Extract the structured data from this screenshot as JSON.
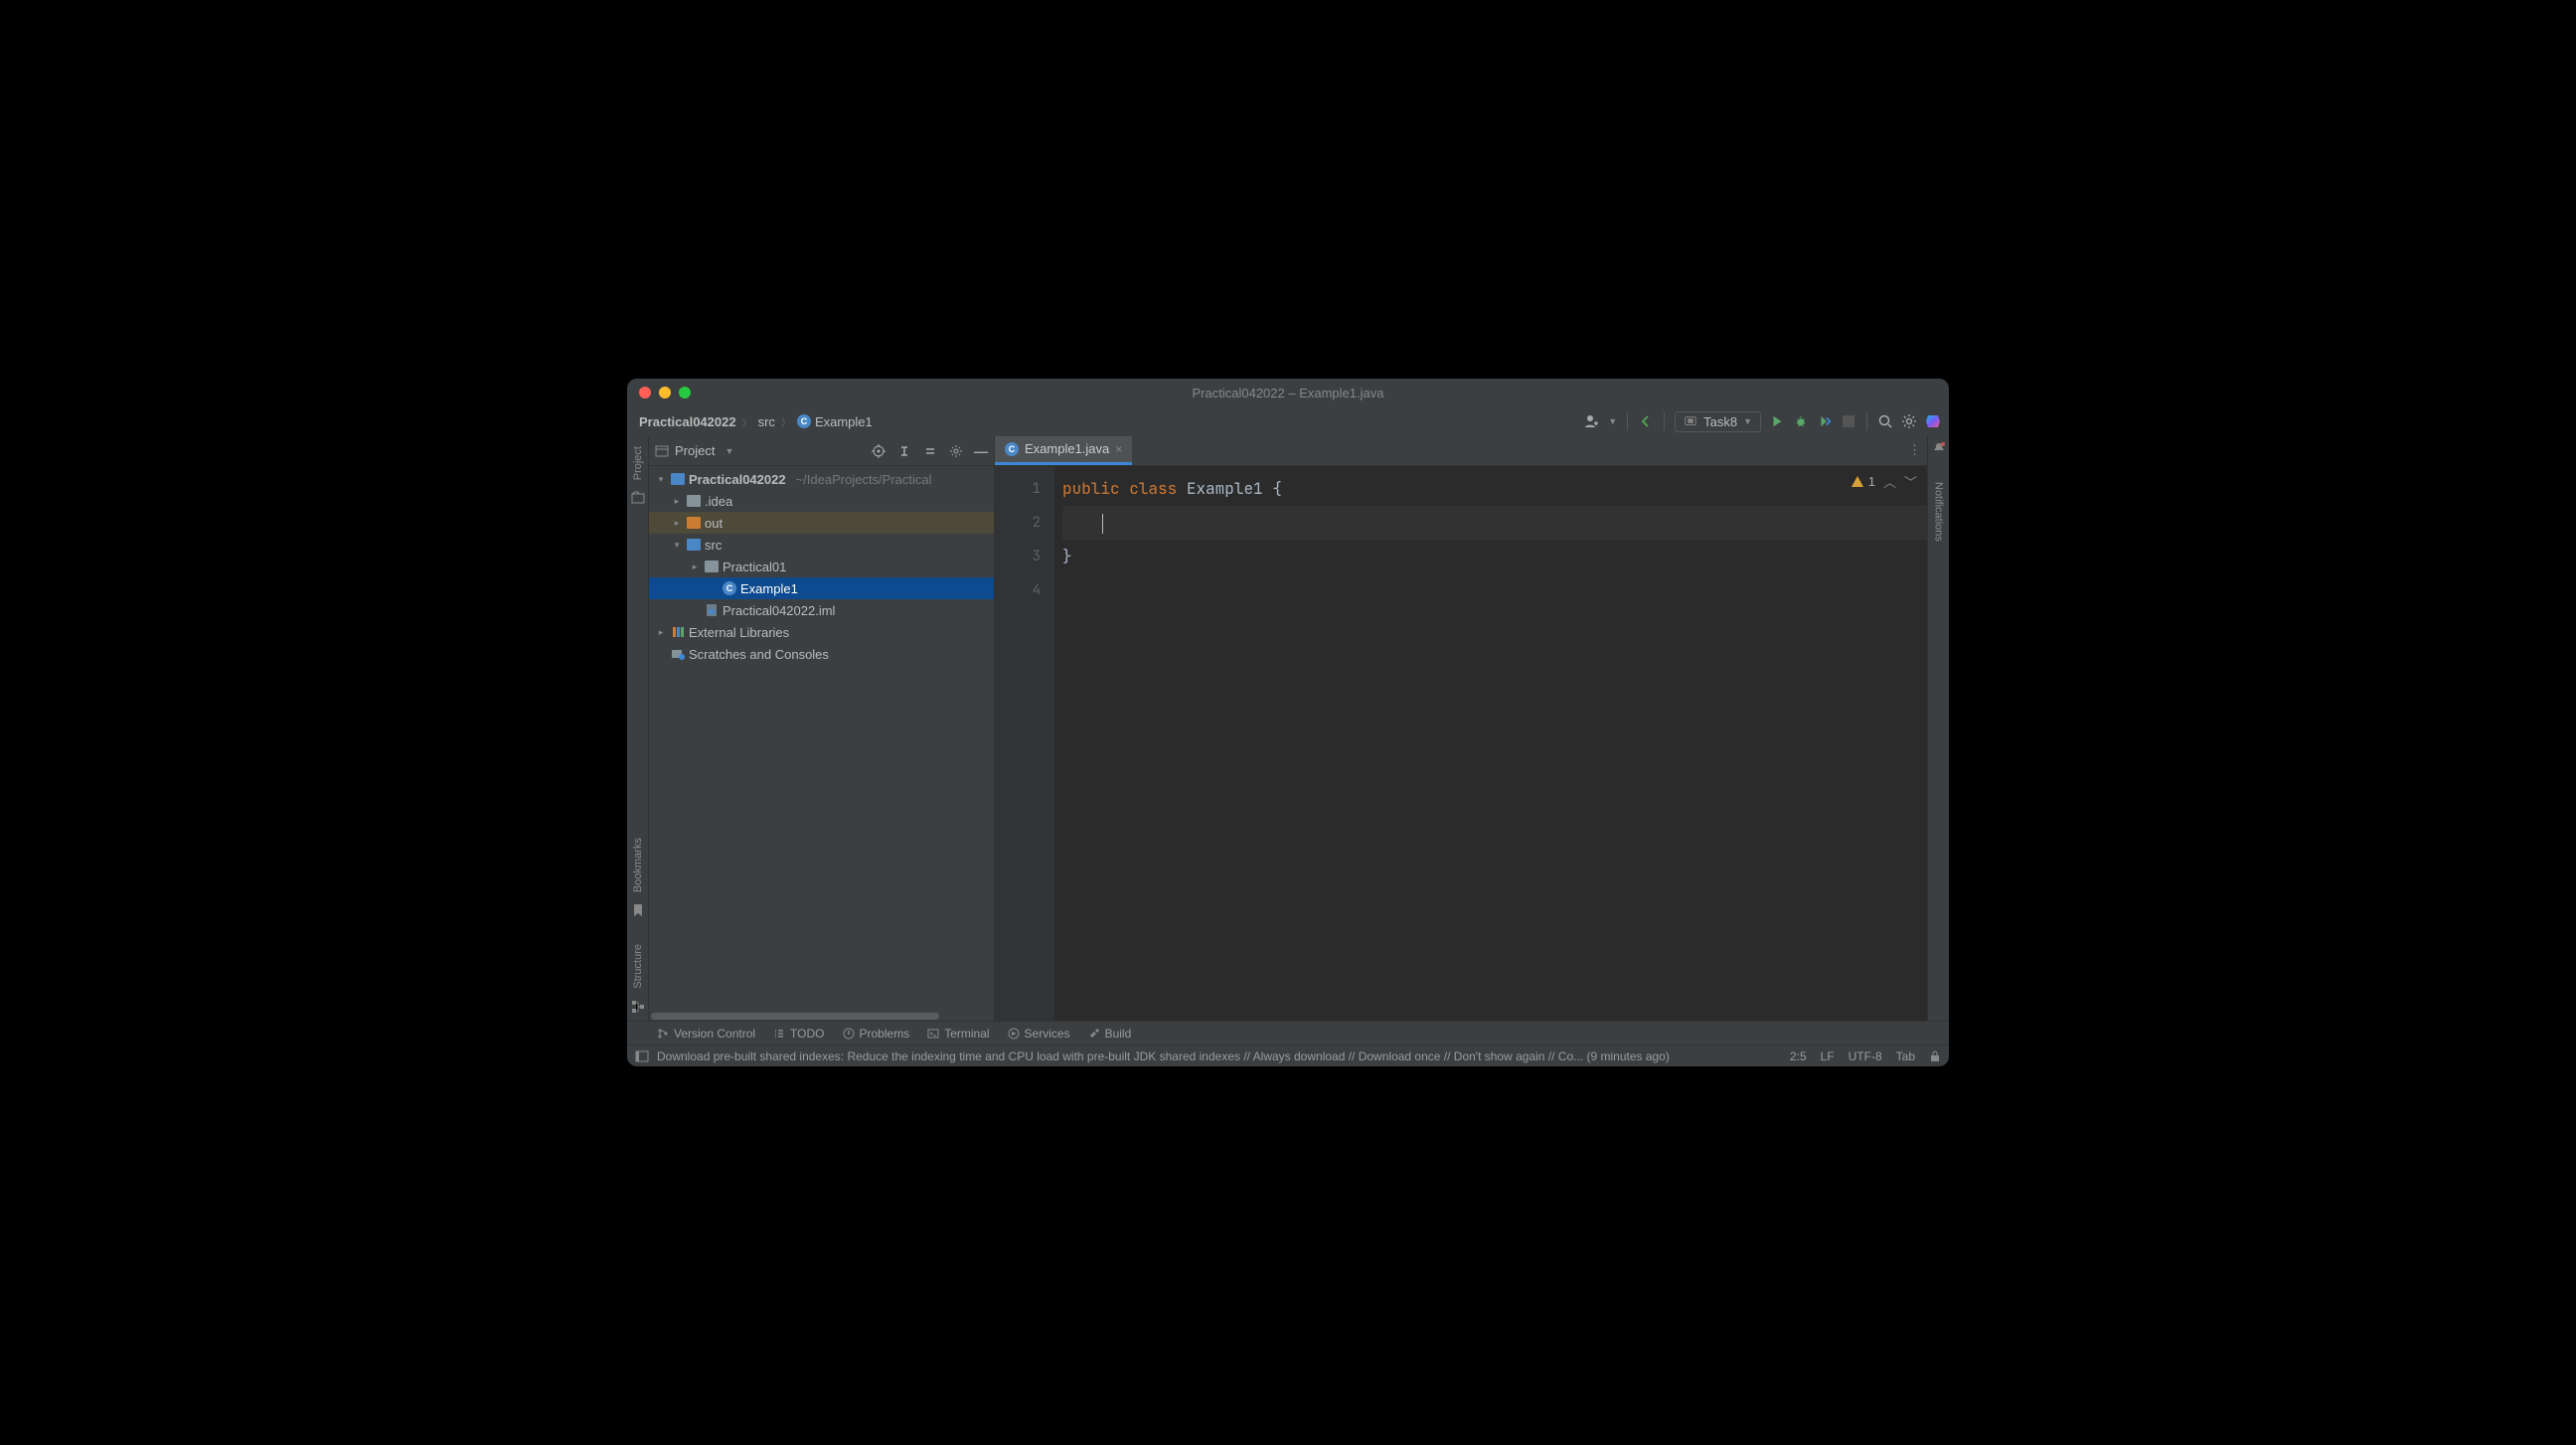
{
  "title": "Practical042022 – Example1.java",
  "breadcrumb": [
    "Practical042022",
    "src",
    "Example1"
  ],
  "runConfig": "Task8",
  "projectViewLabel": "Project",
  "leftGutter": {
    "project": "Project",
    "bookmarks": "Bookmarks",
    "structure": "Structure"
  },
  "rightGutter": {
    "notifications": "Notifications"
  },
  "tree": {
    "root": {
      "name": "Practical042022",
      "path": "~/IdeaProjects/Practical"
    },
    "idea": ".idea",
    "out": "out",
    "src": "src",
    "pkg": "Practical01",
    "cls": "Example1",
    "iml": "Practical042022.iml",
    "ext": "External Libraries",
    "scratch": "Scratches and Consoles"
  },
  "tab": {
    "name": "Example1.java"
  },
  "inspections": {
    "warnings": "1"
  },
  "code": {
    "lines": [
      "1",
      "2",
      "3",
      "4"
    ],
    "line1_kw1": "public",
    "line1_kw2": "class",
    "line1_name": "Example1",
    "line1_brace": "{",
    "line3": "}"
  },
  "bottomTools": {
    "vcs": "Version Control",
    "todo": "TODO",
    "problems": "Problems",
    "terminal": "Terminal",
    "services": "Services",
    "build": "Build"
  },
  "status": {
    "message": "Download pre-built shared indexes: Reduce the indexing time and CPU load with pre-built JDK shared indexes // Always download // Download once // Don't show again // Co... (9 minutes ago)",
    "pos": "2:5",
    "sep": "LF",
    "enc": "UTF-8",
    "indent": "Tab"
  }
}
